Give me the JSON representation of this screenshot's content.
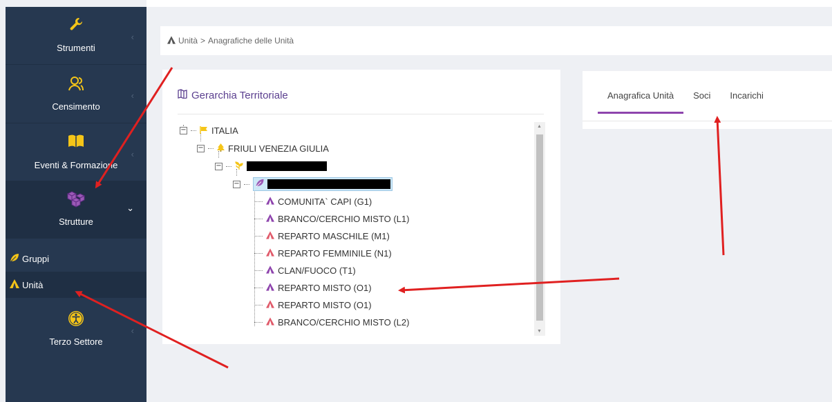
{
  "sidebar": {
    "items": [
      {
        "label": "Strumenti",
        "icon": "wrench-icon"
      },
      {
        "label": "Censimento",
        "icon": "users-icon"
      },
      {
        "label": "Eventi & Formazione",
        "icon": "book-icon"
      },
      {
        "label": "Strutture",
        "icon": "cubes-icon"
      },
      {
        "label": "Terzo Settore",
        "icon": "accessibility-icon"
      }
    ],
    "sub_items": [
      {
        "label": "Gruppi",
        "icon": "leaf-icon"
      },
      {
        "label": "Unità",
        "icon": "tent-icon"
      }
    ]
  },
  "breadcrumb": {
    "root": "Unità",
    "separator": ">",
    "current": "Anagrafiche delle Unità"
  },
  "hierarchy": {
    "title": "Gerarchia Territoriale",
    "root": "ITALIA",
    "region": "FRIULI VENEZIA GIULIA",
    "units": [
      "COMUNITA` CAPI (G1)",
      "BRANCO/CERCHIO MISTO (L1)",
      "REPARTO MASCHILE (M1)",
      "REPARTO FEMMINILE (N1)",
      "CLAN/FUOCO (T1)",
      "REPARTO MISTO (O1)",
      "REPARTO MISTO (O1)",
      "BRANCO/CERCHIO MISTO (L2)"
    ]
  },
  "tabs": {
    "anagrafica": "Anagrafica Unità",
    "soci": "Soci",
    "incarichi": "Incarichi"
  },
  "colors": {
    "sidebar": "#263850",
    "accent": "#8e44ad",
    "arrow": "#e02020",
    "icon_yellow": "#f5c518"
  }
}
